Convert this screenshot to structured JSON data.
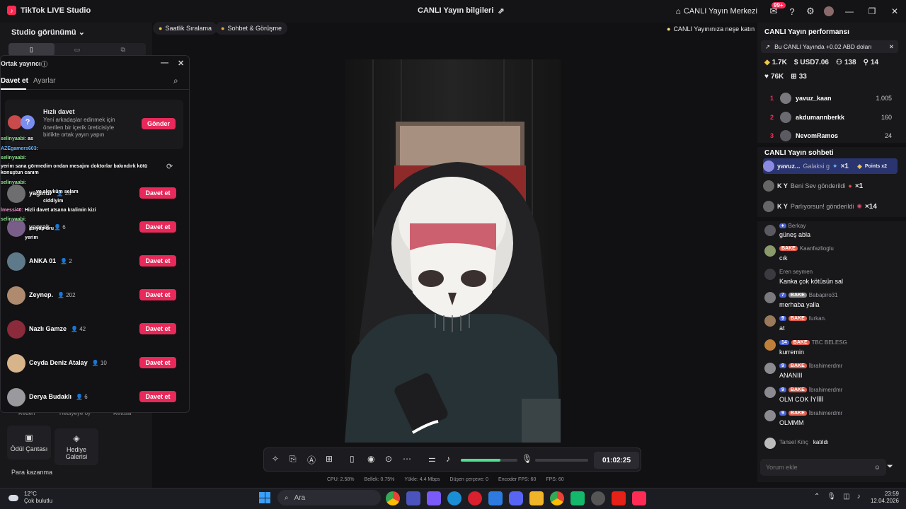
{
  "app": {
    "title": "TikTok LIVE Studio",
    "center_title": "CANLI Yayın bilgileri",
    "live_center": "CANLI Yayın Merkezi",
    "notif_badge": "99+"
  },
  "left": {
    "studio_view": "Studio görünümü",
    "tools": [
      {
        "label": "Ödül Çantası",
        "icon": "bag-icon"
      },
      {
        "label": "Hediye Galerisi",
        "icon": "gift-gallery-icon"
      }
    ],
    "partial_labels": [
      "Redeh",
      "Hediyeye oy",
      "Retosa"
    ],
    "para_kazanma": "Para kazanma"
  },
  "cohost": {
    "title": "Ortak yayıncı",
    "tabs": [
      "Davet et",
      "Ayarlar"
    ],
    "quick_title": "Hızlı davet",
    "quick_desc": "Yeni arkadaşlar edinmek için önerilen bir içerik üreticisiyle birlikte ortak yayın yapın",
    "send": "Gönder",
    "invite_label": "Davet et",
    "rows": [
      {
        "name": "yağmur",
        "viewers": "28"
      },
      {
        "name": "yaprak",
        "viewers": "6"
      },
      {
        "name": "ANKA 01",
        "viewers": "2"
      },
      {
        "name": "Zeynep.",
        "viewers": "202"
      },
      {
        "name": "Nazlı Gamze",
        "viewers": "42"
      },
      {
        "name": "Ceyda Deniz Atalay",
        "viewers": "10"
      },
      {
        "name": "Derya Budaklı",
        "viewers": "6"
      }
    ],
    "overlay_chat": [
      {
        "user": "selinyaabi:",
        "text": "as"
      },
      {
        "user": "AZEgamers603:",
        "text": ""
      },
      {
        "user": "selinyaabi:",
        "text": ""
      },
      {
        "user": "",
        "text": "yerim sana görmedim ondan mesajını doktorlar bakındırk kötü"
      },
      {
        "user": "",
        "text": "konuştun canım"
      },
      {
        "user": "selinyaabi:",
        "text": ""
      },
      {
        "user": "",
        "text": "ve aleyküm selam"
      },
      {
        "user": "",
        "text": "ciddiyim"
      },
      {
        "user": "lmessi40:",
        "text": "Hizli davet atsana kralimin kizi"
      },
      {
        "user": "selinyaabi:",
        "text": ""
      },
      {
        "user": "",
        "text": "asiyap uru"
      },
      {
        "user": "",
        "text": "yerim"
      }
    ]
  },
  "chips": {
    "left1": "Saatlik Sıralama",
    "left2": "Sohbet & Görüşme",
    "right": "CANLI Yayınınıza neşe katın"
  },
  "controls": {
    "timer": "01:02:25"
  },
  "stats": [
    "CPU: 2.58%",
    "Bellek: 0.75%",
    "Yükle: 4.4 Mbps",
    "Düşen çerçeve: 0",
    "Encoder FPS: 60",
    "FPS: 60"
  ],
  "right": {
    "perf_title": "CANLI Yayın performansı",
    "notice": "Bu CANLI Yayında +0.02 ABD doları",
    "stats": {
      "diamonds": "1.7K",
      "usd": "USD7.06",
      "viewers": "138",
      "new_followers": "14",
      "likes": "76K",
      "gifters": "33"
    },
    "ranking": [
      {
        "rank": "1",
        "user": "yavuz_kaan",
        "value": "1.005"
      },
      {
        "rank": "2",
        "user": "akdumannberkk",
        "value": "160"
      },
      {
        "rank": "3",
        "user": "NevomRamos",
        "value": "24"
      }
    ],
    "chat_title": "CANLI Yayın sohbeti",
    "gift_banner": {
      "user": "yavuz...",
      "gift": "Galaksi g",
      "count": "×1",
      "points": "Points x2"
    },
    "gifts": [
      {
        "user": "K Y",
        "text": "Beni Sev gönderildi",
        "count": "×1"
      },
      {
        "user": "K Y",
        "text": "Parlıyorsun! gönderildi",
        "count": "×14"
      }
    ],
    "messages": [
      {
        "user": "Berkay",
        "level": "",
        "fan": "",
        "text": "güneş abla"
      },
      {
        "user": "Kaanfazlioglu",
        "level": "",
        "fan": "BAKE",
        "text": "cık"
      },
      {
        "user": "Eren seymen",
        "level": "",
        "fan": "",
        "text": "Kanka çok kötüsün sal"
      },
      {
        "user": "Babapiro31",
        "level": "7",
        "fan": "BAKE",
        "text": "merhaba yalla"
      },
      {
        "user": "furkan.",
        "level": "9",
        "fan": "BAKE",
        "text": "at"
      },
      {
        "user": "TBC BELESG",
        "level": "14",
        "fan": "BAKE",
        "text": "kurremin"
      },
      {
        "user": "İbrahimerdmr",
        "level": "9",
        "fan": "BAKE",
        "text": "ANANIII"
      },
      {
        "user": "İbrahimerdmr",
        "level": "9",
        "fan": "BAKE",
        "text": "OLM COK İYİİİİ"
      },
      {
        "user": "İbrahimerdmr",
        "level": "9",
        "fan": "BAKE",
        "text": "OLMMM"
      }
    ],
    "joined": {
      "user": "Tansel Kılıç",
      "text": "katıldı"
    },
    "comment_placeholder": "Yorum ekle"
  },
  "taskbar": {
    "temp": "12°C",
    "weather": "Çok bulutlu",
    "search": "Ara",
    "time": "23:59",
    "date": "12.04.2026"
  }
}
